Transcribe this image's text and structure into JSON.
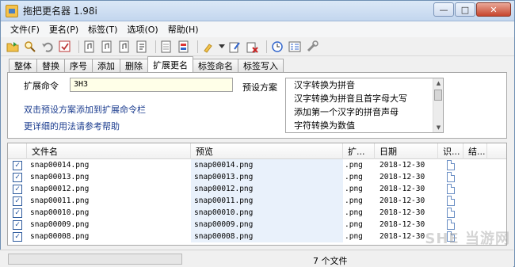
{
  "window": {
    "title": "拖把更名器 1.98i",
    "buttons": {
      "minimize": "—",
      "maximize": "□",
      "close": "✕"
    }
  },
  "menu": [
    "文件(F)",
    "更名(P)",
    "标签(T)",
    "选项(O)",
    "帮助(H)"
  ],
  "toolbar": [
    "folder-open-icon",
    "search-icon",
    "undo-icon",
    "check-icon",
    "music-file-icon",
    "music-file-icon",
    "music-file-icon",
    "music-file-icon",
    "document-icon",
    "document-color-icon",
    "brush-icon",
    "dropdown-icon",
    "tag-edit-icon",
    "tag-delete-icon",
    "clock-icon",
    "list-icon",
    "settings-icon"
  ],
  "tabs": [
    "整体",
    "替换",
    "序号",
    "添加",
    "删除",
    "扩展更名",
    "标签命名",
    "标签写入"
  ],
  "active_tab": "扩展更名",
  "panel": {
    "cmd_label": "扩展命令",
    "cmd_value": "3H3",
    "preset_label": "预设方案",
    "presets": [
      "汉字转换为拼音",
      "汉字转换为拼音且首字母大写",
      "添加第一个汉字的拼音声母",
      "字符转换为数值"
    ],
    "hint1": "双击预设方案添加到扩展命令栏",
    "hint2": "更详细的用法请参考帮助"
  },
  "grid": {
    "headers": [
      "文件名",
      "预览",
      "扩...",
      "日期",
      "识...",
      "结..."
    ],
    "rows": [
      {
        "name": "snap00014.png",
        "preview": "snap00014.png",
        "ext": ".png",
        "date": "2018-12-30"
      },
      {
        "name": "snap00013.png",
        "preview": "snap00013.png",
        "ext": ".png",
        "date": "2018-12-30"
      },
      {
        "name": "snap00012.png",
        "preview": "snap00012.png",
        "ext": ".png",
        "date": "2018-12-30"
      },
      {
        "name": "snap00011.png",
        "preview": "snap00011.png",
        "ext": ".png",
        "date": "2018-12-30"
      },
      {
        "name": "snap00010.png",
        "preview": "snap00010.png",
        "ext": ".png",
        "date": "2018-12-30"
      },
      {
        "name": "snap00009.png",
        "preview": "snap00009.png",
        "ext": ".png",
        "date": "2018-12-30"
      },
      {
        "name": "snap00008.png",
        "preview": "snap00008.png",
        "ext": ".png",
        "date": "2018-12-30"
      }
    ]
  },
  "status": {
    "text": "7 个文件"
  },
  "watermark": "SHE 当游网"
}
